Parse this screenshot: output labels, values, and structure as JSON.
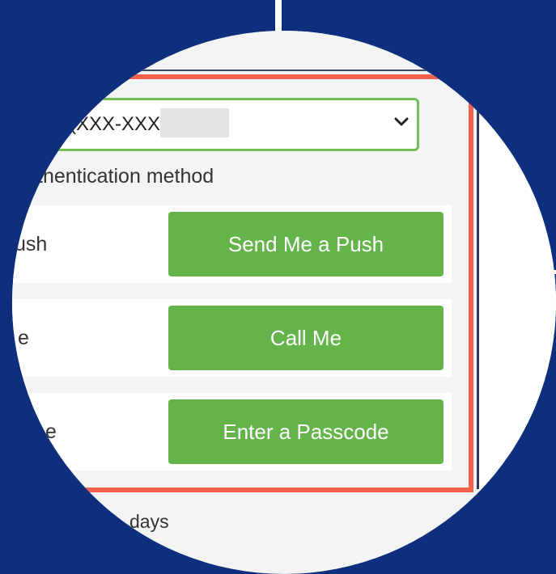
{
  "device_select": {
    "value": "(XXX-XXX-"
  },
  "auth_section": {
    "label": "thentication method"
  },
  "methods": [
    {
      "partial_label": "ush",
      "button": "Send Me a Push"
    },
    {
      "partial_label": "e",
      "button": "Call Me"
    },
    {
      "partial_label": "e",
      "button": "Enter a Passcode"
    }
  ],
  "remember": {
    "partial_label": "days"
  },
  "colors": {
    "background": "#0d2f7e",
    "accent_button": "#64b34b",
    "highlight_frame": "#f1614d",
    "select_border": "#71c058"
  }
}
